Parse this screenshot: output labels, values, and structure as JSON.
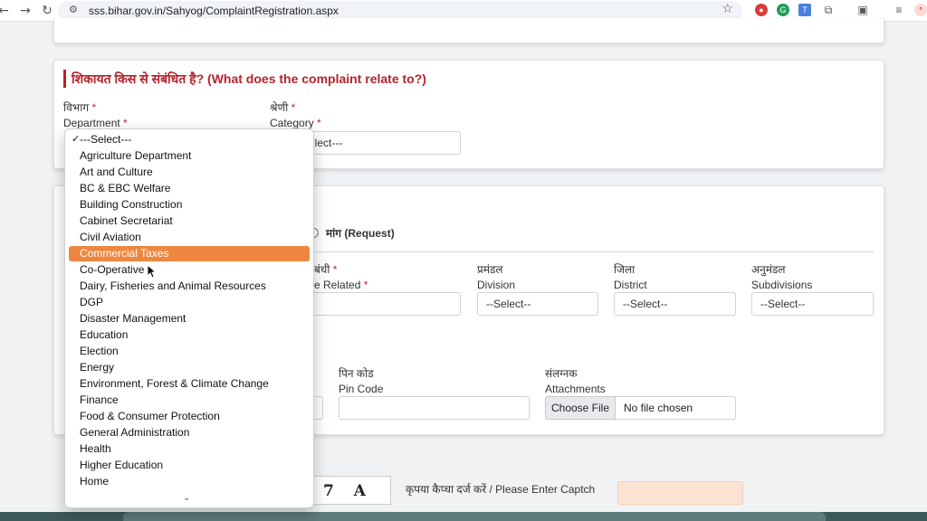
{
  "browser": {
    "url": "sss.bihar.gov.in/Sahyog/ComplaintRegistration.aspx"
  },
  "complaint_section": {
    "title": "शिकायत किस से संबंधित है? (What does the complaint relate to?)",
    "department_hindi": "विभाग",
    "department_en": "Department",
    "category_hindi": "श्रेणी",
    "category_en": "Category",
    "category_value": "elect---",
    "required_mark": "*"
  },
  "details_section": {
    "request_label": "मांग (Request)",
    "related_hindi_partial": "बंधी",
    "related_en_partial": "e Related",
    "division_hindi": "प्रमंडल",
    "division_en": "Division",
    "division_value": "--Select--",
    "district_hindi": "जिला",
    "district_en": "District",
    "district_value": "--Select--",
    "subdivision_hindi": "अनुमंडल",
    "subdivision_en": "Subdivisions",
    "subdivision_value": "--Select--",
    "pincode_hindi": "पिन कोड",
    "pincode_en": "Pin Code",
    "attachments_hindi": "संलग्नक",
    "attachments_en": "Attachments",
    "choose_file": "Choose File",
    "no_file": "No file chosen"
  },
  "captcha": {
    "partial_text": "7 A",
    "prompt": "कृपया कैप्चा दर्ज करें / Please Enter Captch"
  },
  "department_dropdown": {
    "selected": "---Select---",
    "highlighted": "Commercial Taxes",
    "options": [
      "---Select---",
      "Agriculture Department",
      "Art and Culture",
      "BC & EBC Welfare",
      "Building Construction",
      "Cabinet Secretariat",
      "Civil Aviation",
      "Commercial Taxes",
      "Co-Operative",
      "Dairy, Fisheries and Animal Resources",
      "DGP",
      "Disaster Management",
      "Education",
      "Election",
      "Energy",
      "Environment, Forest & Climate Change",
      "Finance",
      "Food & Consumer Protection",
      "General Administration",
      "Health",
      "Higher Education",
      "Home"
    ]
  },
  "colors": {
    "section_title": "#b5242c",
    "highlight": "#ee8640",
    "captcha_input": "#fbe3d4"
  }
}
